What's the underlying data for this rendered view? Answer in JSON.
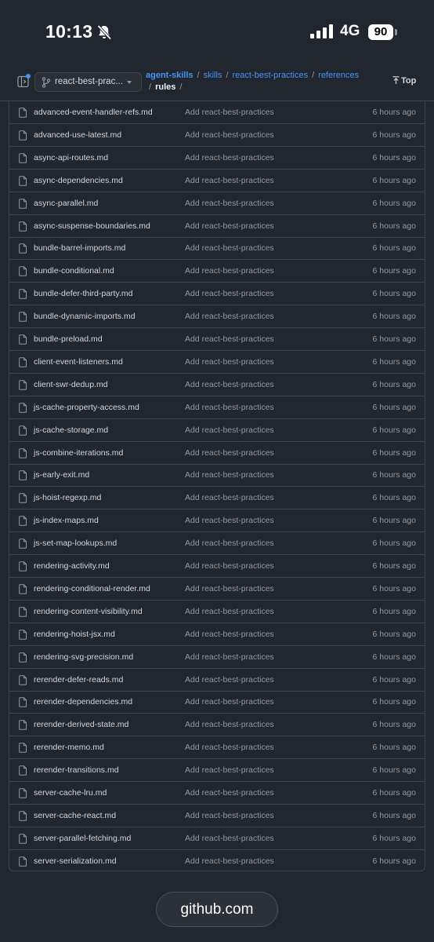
{
  "status_bar": {
    "time": "10:13",
    "network": "4G",
    "battery": "90"
  },
  "header": {
    "branch": "react-best-prac...",
    "breadcrumb": [
      "agent-skills",
      "skills",
      "react-best-practices",
      "references"
    ],
    "current": "rules",
    "top_label": "Top"
  },
  "files": [
    {
      "name": "advanced-event-handler-refs.md",
      "message": "Add react-best-practices",
      "date": "6 hours ago"
    },
    {
      "name": "advanced-use-latest.md",
      "message": "Add react-best-practices",
      "date": "6 hours ago"
    },
    {
      "name": "async-api-routes.md",
      "message": "Add react-best-practices",
      "date": "6 hours ago"
    },
    {
      "name": "async-dependencies.md",
      "message": "Add react-best-practices",
      "date": "6 hours ago"
    },
    {
      "name": "async-parallel.md",
      "message": "Add react-best-practices",
      "date": "6 hours ago"
    },
    {
      "name": "async-suspense-boundaries.md",
      "message": "Add react-best-practices",
      "date": "6 hours ago"
    },
    {
      "name": "bundle-barrel-imports.md",
      "message": "Add react-best-practices",
      "date": "6 hours ago"
    },
    {
      "name": "bundle-conditional.md",
      "message": "Add react-best-practices",
      "date": "6 hours ago"
    },
    {
      "name": "bundle-defer-third-party.md",
      "message": "Add react-best-practices",
      "date": "6 hours ago"
    },
    {
      "name": "bundle-dynamic-imports.md",
      "message": "Add react-best-practices",
      "date": "6 hours ago"
    },
    {
      "name": "bundle-preload.md",
      "message": "Add react-best-practices",
      "date": "6 hours ago"
    },
    {
      "name": "client-event-listeners.md",
      "message": "Add react-best-practices",
      "date": "6 hours ago"
    },
    {
      "name": "client-swr-dedup.md",
      "message": "Add react-best-practices",
      "date": "6 hours ago"
    },
    {
      "name": "js-cache-property-access.md",
      "message": "Add react-best-practices",
      "date": "6 hours ago"
    },
    {
      "name": "js-cache-storage.md",
      "message": "Add react-best-practices",
      "date": "6 hours ago"
    },
    {
      "name": "js-combine-iterations.md",
      "message": "Add react-best-practices",
      "date": "6 hours ago"
    },
    {
      "name": "js-early-exit.md",
      "message": "Add react-best-practices",
      "date": "6 hours ago"
    },
    {
      "name": "js-hoist-regexp.md",
      "message": "Add react-best-practices",
      "date": "6 hours ago"
    },
    {
      "name": "js-index-maps.md",
      "message": "Add react-best-practices",
      "date": "6 hours ago"
    },
    {
      "name": "js-set-map-lookups.md",
      "message": "Add react-best-practices",
      "date": "6 hours ago"
    },
    {
      "name": "rendering-activity.md",
      "message": "Add react-best-practices",
      "date": "6 hours ago"
    },
    {
      "name": "rendering-conditional-render.md",
      "message": "Add react-best-practices",
      "date": "6 hours ago"
    },
    {
      "name": "rendering-content-visibility.md",
      "message": "Add react-best-practices",
      "date": "6 hours ago"
    },
    {
      "name": "rendering-hoist-jsx.md",
      "message": "Add react-best-practices",
      "date": "6 hours ago"
    },
    {
      "name": "rendering-svg-precision.md",
      "message": "Add react-best-practices",
      "date": "6 hours ago"
    },
    {
      "name": "rerender-defer-reads.md",
      "message": "Add react-best-practices",
      "date": "6 hours ago"
    },
    {
      "name": "rerender-dependencies.md",
      "message": "Add react-best-practices",
      "date": "6 hours ago"
    },
    {
      "name": "rerender-derived-state.md",
      "message": "Add react-best-practices",
      "date": "6 hours ago"
    },
    {
      "name": "rerender-memo.md",
      "message": "Add react-best-practices",
      "date": "6 hours ago"
    },
    {
      "name": "rerender-transitions.md",
      "message": "Add react-best-practices",
      "date": "6 hours ago"
    },
    {
      "name": "server-cache-lru.md",
      "message": "Add react-best-practices",
      "date": "6 hours ago"
    },
    {
      "name": "server-cache-react.md",
      "message": "Add react-best-practices",
      "date": "6 hours ago"
    },
    {
      "name": "server-parallel-fetching.md",
      "message": "Add react-best-practices",
      "date": "6 hours ago"
    },
    {
      "name": "server-serialization.md",
      "message": "Add react-best-practices",
      "date": "6 hours ago"
    }
  ],
  "url_bar": {
    "domain": "github.com"
  }
}
